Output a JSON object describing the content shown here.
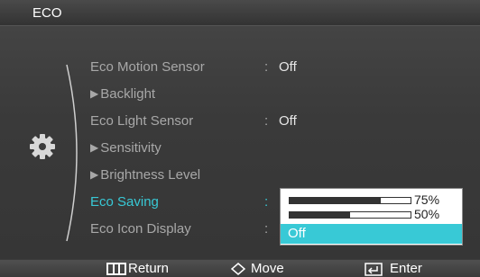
{
  "window": {
    "title": "ECO"
  },
  "menu": {
    "items": [
      {
        "label": "Eco Motion Sensor",
        "value": "Off",
        "sub": false,
        "active": false
      },
      {
        "label": "Backlight",
        "value": "",
        "sub": true,
        "active": false
      },
      {
        "label": "Eco Light Sensor",
        "value": "Off",
        "sub": false,
        "active": false
      },
      {
        "label": "Sensitivity",
        "value": "",
        "sub": true,
        "active": false
      },
      {
        "label": "Brightness Level",
        "value": "",
        "sub": true,
        "active": false
      },
      {
        "label": "Eco Saving",
        "value": "",
        "sub": false,
        "active": true
      },
      {
        "label": "Eco Icon Display",
        "value": "",
        "sub": false,
        "active": false
      }
    ],
    "separator": ":"
  },
  "dropdown": {
    "options": [
      {
        "label": "75%",
        "level": 0.75
      },
      {
        "label": "50%",
        "level": 0.5
      },
      {
        "label": "Off",
        "selected": true
      }
    ]
  },
  "footer": {
    "return_label": "Return",
    "move_label": "Move",
    "enter_label": "Enter"
  },
  "colors": {
    "accent": "#38c9d6",
    "background": "#3b3b3b"
  },
  "icons": {
    "side": "gear-icon",
    "return": "menu-return-icon",
    "move": "diamond-move-icon",
    "enter": "enter-icon"
  }
}
